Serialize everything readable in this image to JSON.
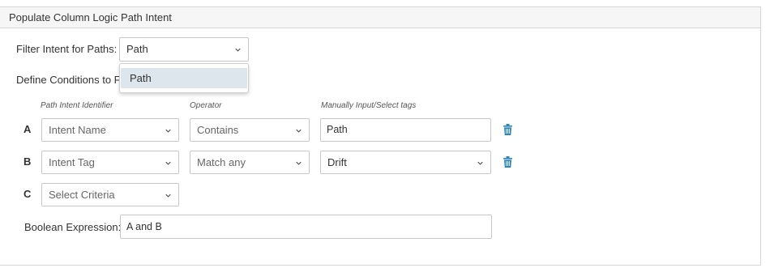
{
  "panel": {
    "title": "Populate Column Logic Path Intent"
  },
  "filter": {
    "label": "Filter Intent for Paths:",
    "selected": "Path",
    "options": [
      "Path"
    ]
  },
  "define_conditions": {
    "label": "Define Conditions to Fi"
  },
  "columns": {
    "identifier": "Path Intent Identifier",
    "operator": "Operator",
    "tags": "Manually Input/Select tags"
  },
  "rows": [
    {
      "letter": "A",
      "identifier": "Intent Name",
      "operator": "Contains",
      "value": "Path"
    },
    {
      "letter": "B",
      "identifier": "Intent Tag",
      "operator": "Match any",
      "value": "Drift"
    },
    {
      "letter": "C",
      "identifier": "Select Criteria"
    }
  ],
  "boolean": {
    "label": "Boolean Expression:",
    "value": "A and B"
  },
  "colors": {
    "trash": "#2e86c1",
    "highlight": "#dde6ec",
    "border": "#c8c8c8"
  },
  "icons": {
    "dropdown": "chevron-down-icon",
    "delete": "trash-icon"
  }
}
